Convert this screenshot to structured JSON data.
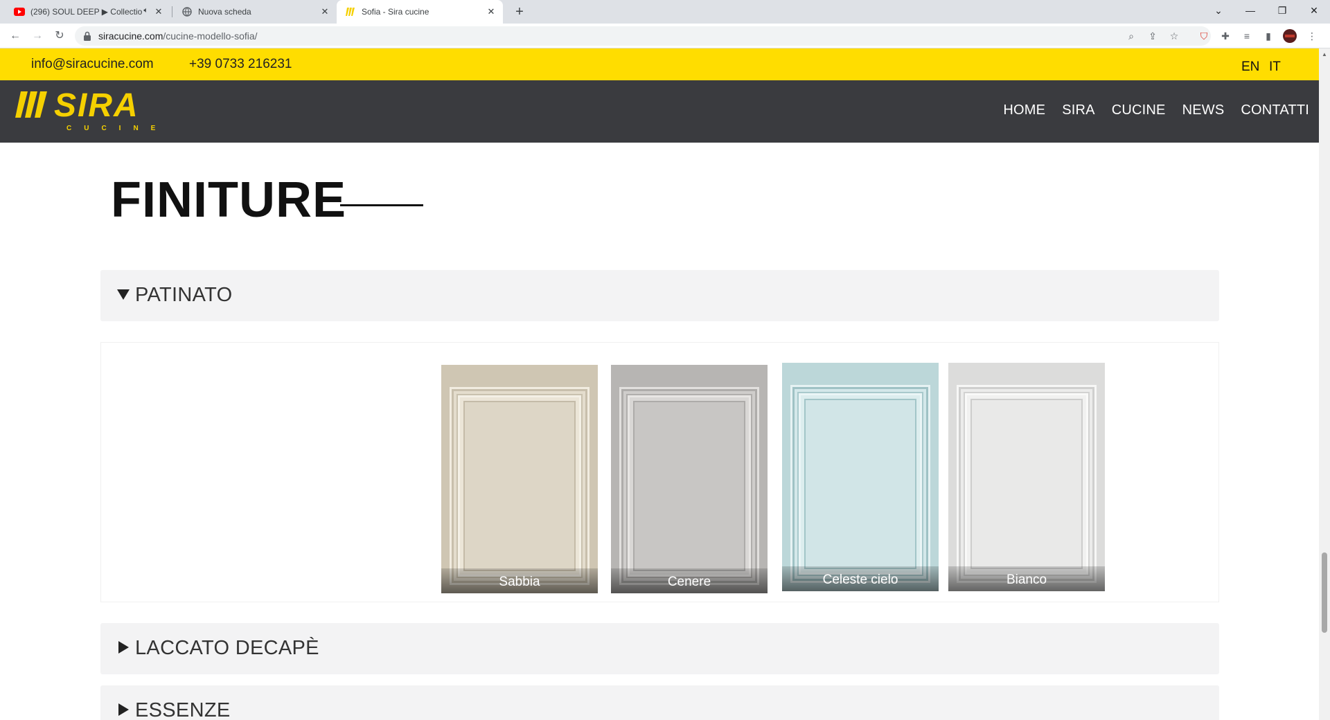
{
  "browser": {
    "tabs": [
      {
        "title": "(296) SOUL DEEP ▶ Collectio",
        "icon": "youtube-icon",
        "muted": true,
        "active": false
      },
      {
        "title": "Nuova scheda",
        "icon": "globe-icon",
        "active": false
      },
      {
        "title": "Sofia - Sira cucine",
        "icon": "sira-favicon-icon",
        "active": true
      }
    ],
    "new_tab": "+",
    "url_domain": "siracucine.com",
    "url_path": "/cucine-modello-sofia/"
  },
  "site": {
    "topbar": {
      "email": "info@siracucine.com",
      "phone": "+39 0733 216231",
      "lang_en": "EN",
      "lang_it": "IT",
      "bg_color": "#ffdd00"
    },
    "logo": {
      "main": "SIRA",
      "sub": "CUCINE"
    },
    "nav": [
      "HOME",
      "SIRA",
      "CUCINE",
      "NEWS",
      "CONTATTI"
    ],
    "nav_bg": "#3a3b3f"
  },
  "section": {
    "title": "FINITURE",
    "accordions": [
      {
        "label": "PATINATO",
        "expanded": true,
        "swatches": [
          {
            "name": "Sabbia",
            "color": "#d9d2c2"
          },
          {
            "name": "Cenere",
            "color": "#c9c7c5"
          },
          {
            "name": "Celeste cielo",
            "color": "#d3e6e8"
          },
          {
            "name": "Bianco",
            "color": "#ececeb"
          }
        ]
      },
      {
        "label": "LACCATO DECAPÈ",
        "expanded": false
      },
      {
        "label": "ESSENZE",
        "expanded": false
      }
    ]
  }
}
